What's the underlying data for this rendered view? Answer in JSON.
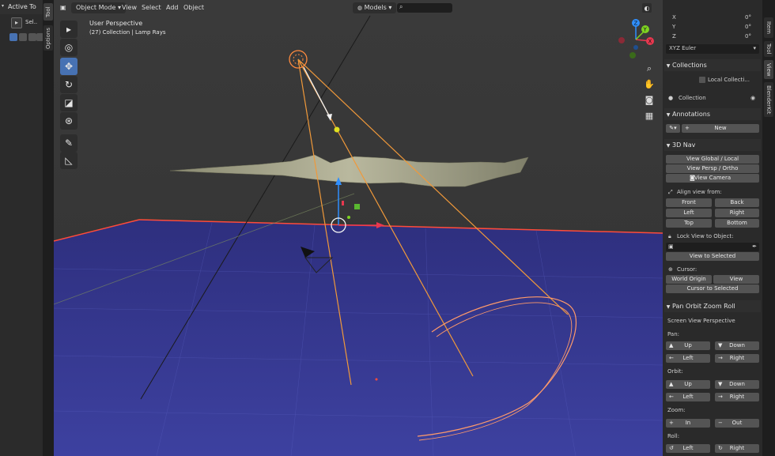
{
  "left_panel": {
    "header_title": "Active To",
    "tool_label": "Sel..",
    "tabs": [
      "Tool",
      "Options"
    ]
  },
  "viewport_header": {
    "mode": "Object Mode",
    "menus": [
      "View",
      "Select",
      "Add",
      "Object"
    ],
    "search_value": "Models",
    "search_placeholder": ""
  },
  "viewport_overlay": {
    "perspective": "User Perspective",
    "collection_info": "(27) Collection | Lamp Rays"
  },
  "toolbar_icons": [
    "select-box-icon",
    "cursor-icon",
    "move-icon",
    "rotate-icon",
    "scale-icon",
    "transform-icon",
    "annotate-icon",
    "measure-icon"
  ],
  "gizmo": {
    "x": "X",
    "y": "Y",
    "z": "Z",
    "x_color": "#e8384f",
    "y_color": "#7ed321",
    "z_color": "#2f8fff"
  },
  "transform": {
    "x_label": "X",
    "x_value": "0°",
    "y_label": "Y",
    "y_value": "0°",
    "z_label": "Z",
    "z_value": "0°",
    "rotation_mode": "XYZ Euler"
  },
  "collections": {
    "header": "Collections",
    "local_label": "Local Collecti...",
    "item": "Collection"
  },
  "annotations": {
    "header": "Annotations",
    "new_label": "New"
  },
  "nav3d": {
    "header": "3D Nav",
    "view_global_local": "View Global / Local",
    "view_persp_ortho": "View Persp / Ortho",
    "view_camera": "View Camera",
    "align_label": "Align view from:",
    "front": "Front",
    "back": "Back",
    "left": "Left",
    "right": "Right",
    "top": "Top",
    "bottom": "Bottom",
    "lock_label": "Lock View to Object:",
    "view_selected": "View to Selected",
    "cursor_label": "Cursor:",
    "world_origin": "World Origin",
    "view": "View",
    "cursor_to_selected": "Cursor to Selected"
  },
  "pan_orbit": {
    "header": "Pan Orbit Zoom Roll",
    "screen_view": "Screen View Perspective",
    "pan_label": "Pan:",
    "orbit_label": "Orbit:",
    "zoom_label": "Zoom:",
    "roll_label": "Roll:",
    "up": "Up",
    "down": "Down",
    "left": "Left",
    "right": "Right",
    "in": "In",
    "out": "Out"
  },
  "right_tabs": [
    "Item",
    "Tool",
    "View",
    "BlenderKit"
  ],
  "colors": {
    "accent": "#4772b3",
    "floor": "#3b3f9a",
    "floor_edge": "#ff4b3a",
    "light_rays": "#f0993a",
    "selected_outline": "#ff8a3d"
  }
}
